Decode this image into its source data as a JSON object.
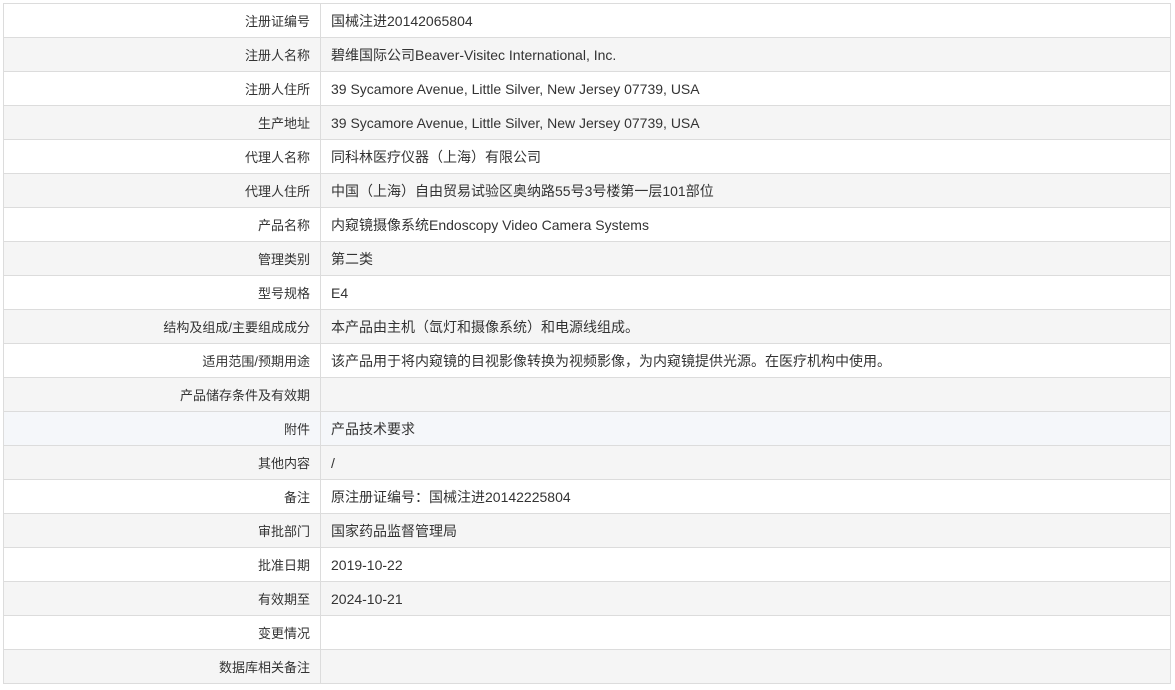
{
  "rows": [
    {
      "label": "注册证编号",
      "value": "国械注进20142065804"
    },
    {
      "label": "注册人名称",
      "value": "碧维国际公司Beaver-Visitec International, Inc."
    },
    {
      "label": "注册人住所",
      "value": "39 Sycamore Avenue, Little Silver, New Jersey 07739, USA"
    },
    {
      "label": "生产地址",
      "value": "39 Sycamore Avenue, Little Silver, New Jersey 07739, USA"
    },
    {
      "label": "代理人名称",
      "value": "同科林医疗仪器（上海）有限公司"
    },
    {
      "label": "代理人住所",
      "value": "中国（上海）自由贸易试验区奥纳路55号3号楼第一层101部位"
    },
    {
      "label": "产品名称",
      "value": "内窥镜摄像系统Endoscopy Video Camera Systems"
    },
    {
      "label": "管理类别",
      "value": "第二类"
    },
    {
      "label": "型号规格",
      "value": "E4"
    },
    {
      "label": "结构及组成/主要组成成分",
      "value": "本产品由主机（氙灯和摄像系统）和电源线组成。"
    },
    {
      "label": "适用范围/预期用途",
      "value": "该产品用于将内窥镜的目视影像转换为视频影像，为内窥镜提供光源。在医疗机构中使用。"
    },
    {
      "label": "产品储存条件及有效期",
      "value": ""
    },
    {
      "label": "附件",
      "value": "产品技术要求"
    },
    {
      "label": "其他内容",
      "value": "/"
    },
    {
      "label": "备注",
      "value": "原注册证编号：国械注进20142225804"
    },
    {
      "label": "审批部门",
      "value": "国家药品监督管理局"
    },
    {
      "label": "批准日期",
      "value": "2019-10-22"
    },
    {
      "label": "有效期至",
      "value": "2024-10-21"
    },
    {
      "label": "变更情况",
      "value": ""
    },
    {
      "label": "数据库相关备注",
      "value": ""
    }
  ]
}
